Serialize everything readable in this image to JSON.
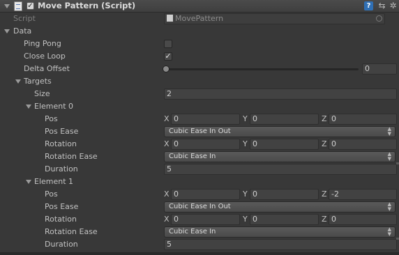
{
  "component": {
    "title": "Move Pattern (Script)",
    "enabled": true,
    "icons": [
      "script-icon",
      "help-icon",
      "preset-icon",
      "gear-icon"
    ]
  },
  "script_field": {
    "label": "Script",
    "value": "MovePattern"
  },
  "data": {
    "label": "Data",
    "ping_pong": {
      "label": "Ping Pong",
      "checked": false
    },
    "close_loop": {
      "label": "Close Loop",
      "checked": true
    },
    "delta_offset": {
      "label": "Delta Offset",
      "value": "0",
      "slider_fraction": 0
    },
    "targets": {
      "label": "Targets",
      "size_label": "Size",
      "size": "2",
      "elements": [
        {
          "label": "Element 0",
          "pos": {
            "label": "Pos",
            "x": "0",
            "y": "0",
            "z": "0"
          },
          "pos_ease": {
            "label": "Pos Ease",
            "value": "Cubic Ease In Out"
          },
          "rotation": {
            "label": "Rotation",
            "x": "0",
            "y": "0",
            "z": "0"
          },
          "rotation_ease": {
            "label": "Rotation Ease",
            "value": "Cubic Ease In"
          },
          "duration": {
            "label": "Duration",
            "value": "5"
          }
        },
        {
          "label": "Element 1",
          "pos": {
            "label": "Pos",
            "x": "0",
            "y": "0",
            "z": "-2"
          },
          "pos_ease": {
            "label": "Pos Ease",
            "value": "Cubic Ease In Out"
          },
          "rotation": {
            "label": "Rotation",
            "x": "0",
            "y": "0",
            "z": "0"
          },
          "rotation_ease": {
            "label": "Rotation Ease",
            "value": "Cubic Ease In"
          },
          "duration": {
            "label": "Duration",
            "value": "5"
          }
        }
      ]
    }
  },
  "axes": {
    "x": "X",
    "y": "Y",
    "z": "Z"
  },
  "glyphs": {
    "check": "✓",
    "dropdown_arrows": "▲▼",
    "preset": "⇆",
    "gear": "✲",
    "help": "?"
  }
}
